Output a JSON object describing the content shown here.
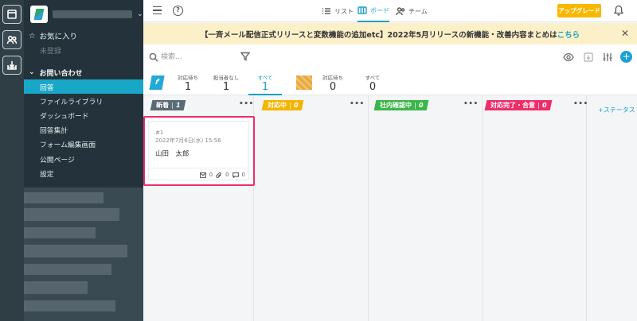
{
  "sidebar": {
    "favorites_label": "お気に入り",
    "unregistered_label": "未登録",
    "group_title": "お問い合わせ",
    "items": [
      {
        "label": "回答",
        "active": true
      },
      {
        "label": "ファイルライブラリ"
      },
      {
        "label": "ダッシュボード"
      },
      {
        "label": "回答集計"
      },
      {
        "label": "フォーム編集画面"
      },
      {
        "label": "公開ページ"
      },
      {
        "label": "設定"
      }
    ]
  },
  "topbar": {
    "tabs": [
      {
        "label": "リスト",
        "icon": "list-icon"
      },
      {
        "label": "ボード",
        "icon": "board-icon",
        "active": true
      },
      {
        "label": "チーム",
        "icon": "team-icon"
      }
    ],
    "upgrade_label": "アップグレード",
    "help_glyph": "?"
  },
  "banner": {
    "text": "【一斉メール配信正式リリースと変数機能の追加etc】2022年5月リリースの新機能・改善内容まとめは",
    "link": "こちら",
    "close": "✕"
  },
  "toolbar": {
    "search_placeholder": "検索...",
    "add_glyph": "+"
  },
  "stats": {
    "badge_letter": "f",
    "groups": [
      {
        "label": "対応待ち",
        "value": "1"
      },
      {
        "label": "担当者なし",
        "value": "1"
      },
      {
        "label": "すべて",
        "value": "1",
        "active": true
      },
      {
        "label": "対応待ち",
        "value": "0"
      },
      {
        "label": "すべて",
        "value": "0"
      }
    ]
  },
  "board": {
    "columns": [
      {
        "name": "新着",
        "count": "1",
        "color": "#5b6b75"
      },
      {
        "name": "対応中",
        "count": "0",
        "color": "#f3b400"
      },
      {
        "name": "社内確認中",
        "count": "0",
        "color": "#3cb54a"
      },
      {
        "name": "対応完了・合意",
        "count": "0",
        "color": "#ec2e6b"
      }
    ],
    "dots": "•••",
    "add_status_label": "+ステータス",
    "card": {
      "id": "#1",
      "date": "2022年7月6日(水) 15:56",
      "name": "山田　太郎",
      "mail_count": "0",
      "attach_count": "0",
      "comment_count": "0"
    }
  }
}
